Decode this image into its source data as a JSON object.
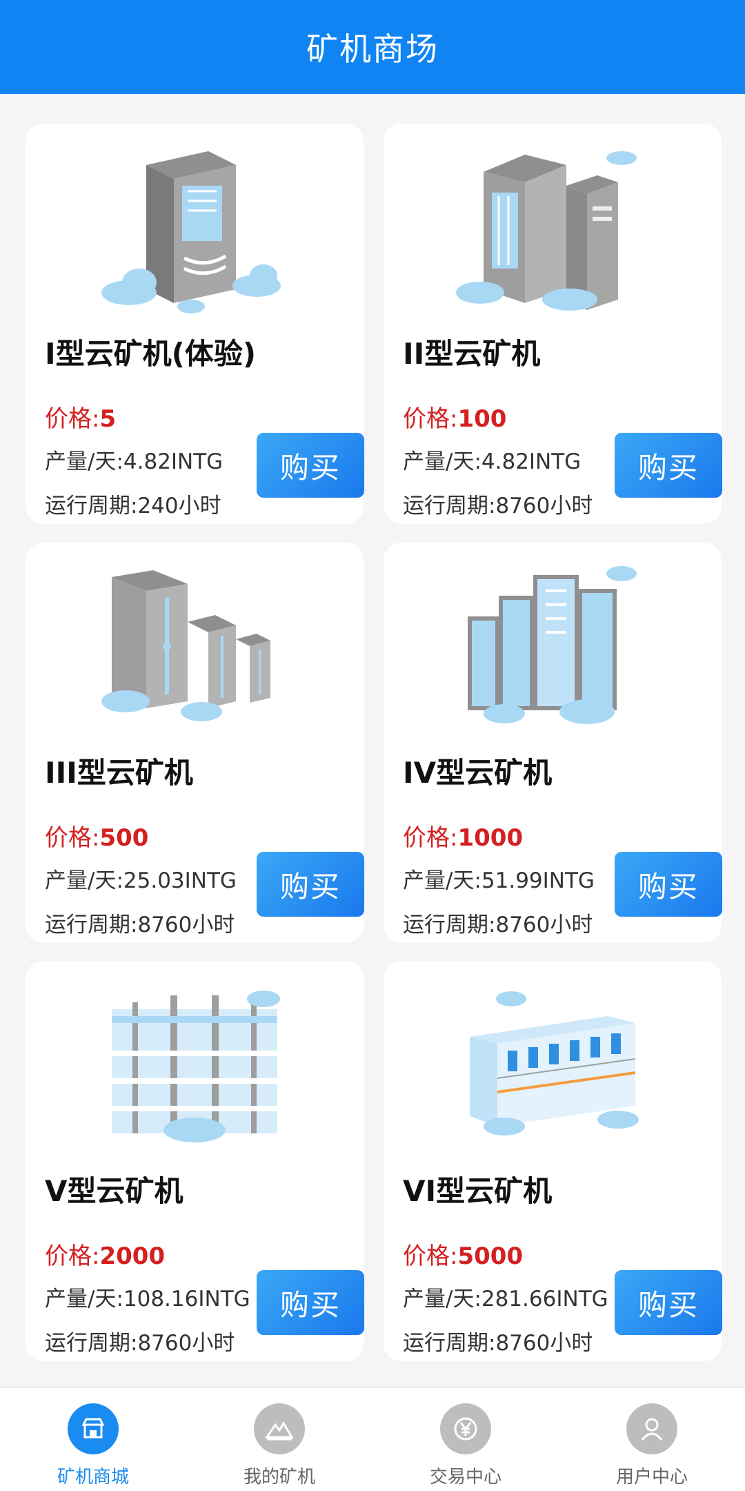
{
  "header": {
    "title": "矿机商场"
  },
  "products": [
    {
      "name": "I型云矿机(体验)",
      "price_label": "价格:",
      "price": "5",
      "output": "产量/天:4.82INTG",
      "cycle": "运行周期:240小时",
      "buy_label": "购买",
      "icon": "single-server-tower-icon"
    },
    {
      "name": "II型云矿机",
      "price_label": "价格:",
      "price": "100",
      "output": "产量/天:4.82INTG",
      "cycle": "运行周期:8760小时",
      "buy_label": "购买",
      "icon": "twin-server-towers-icon"
    },
    {
      "name": "III型云矿机",
      "price_label": "价格:",
      "price": "500",
      "output": "产量/天:25.03INTG",
      "cycle": "运行周期:8760小时",
      "buy_label": "购买",
      "icon": "three-server-towers-icon"
    },
    {
      "name": "IV型云矿机",
      "price_label": "价格:",
      "price": "1000",
      "output": "产量/天:51.99INTG",
      "cycle": "运行周期:8760小时",
      "buy_label": "购买",
      "icon": "server-rack-cluster-icon"
    },
    {
      "name": "V型云矿机",
      "price_label": "价格:",
      "price": "2000",
      "output": "产量/天:108.16INTG",
      "cycle": "运行周期:8760小时",
      "buy_label": "购买",
      "icon": "server-rack-row-icon"
    },
    {
      "name": "VI型云矿机",
      "price_label": "价格:",
      "price": "5000",
      "output": "产量/天:281.66INTG",
      "cycle": "运行周期:8760小时",
      "buy_label": "购买",
      "icon": "data-center-icon"
    }
  ],
  "tabbar": {
    "items": [
      {
        "label": "矿机商城",
        "icon": "store-icon",
        "active": true
      },
      {
        "label": "我的矿机",
        "icon": "mountain-icon",
        "active": false
      },
      {
        "label": "交易中心",
        "icon": "yen-exchange-icon",
        "active": false
      },
      {
        "label": "用户中心",
        "icon": "user-icon",
        "active": false
      }
    ]
  },
  "colors": {
    "primary": "#0f84f2",
    "price": "#d42020",
    "server_gray": "#9e9e9e",
    "server_blue": "#a9d8f5"
  }
}
